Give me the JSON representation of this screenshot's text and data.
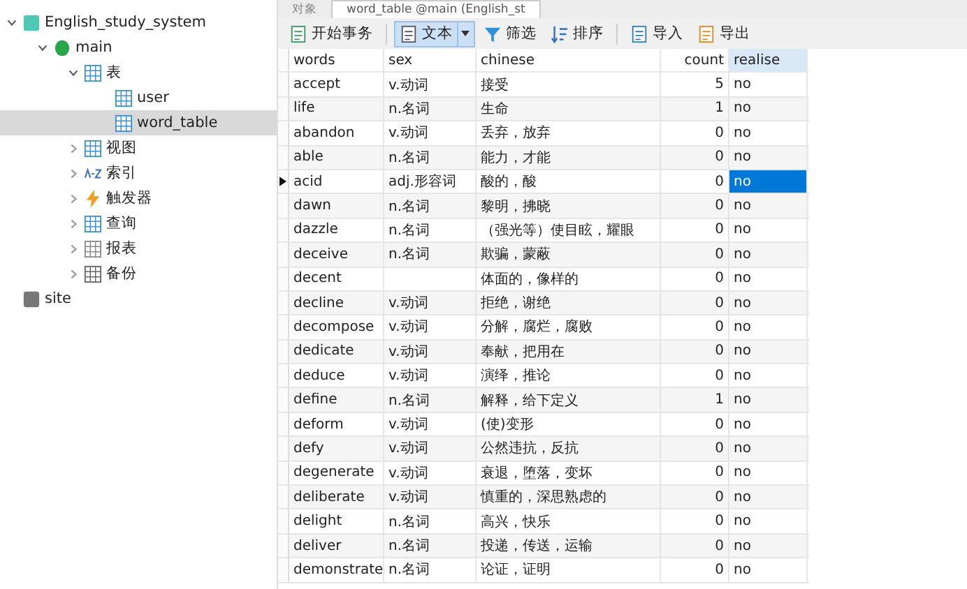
{
  "sidebar": {
    "tree": [
      {
        "label": "English_study_system",
        "kind": "connection",
        "expanded": true,
        "selected": false,
        "children": [
          {
            "label": "main",
            "kind": "database",
            "expanded": true,
            "selected": false,
            "children": [
              {
                "label": "表",
                "kind": "tables",
                "expanded": true,
                "selected": false,
                "children": [
                  {
                    "label": "user",
                    "kind": "table",
                    "selected": false
                  },
                  {
                    "label": "word_table",
                    "kind": "table",
                    "selected": true
                  }
                ]
              },
              {
                "label": "视图",
                "kind": "views",
                "expanded": false,
                "selected": false
              },
              {
                "label": "索引",
                "kind": "indexes",
                "expanded": false,
                "selected": false
              },
              {
                "label": "触发器",
                "kind": "triggers",
                "expanded": false,
                "selected": false
              },
              {
                "label": "查询",
                "kind": "queries",
                "expanded": false,
                "selected": false
              },
              {
                "label": "报表",
                "kind": "reports",
                "expanded": false,
                "selected": false
              },
              {
                "label": "备份",
                "kind": "backups",
                "expanded": false,
                "selected": false
              }
            ]
          }
        ]
      },
      {
        "label": "site",
        "kind": "connection-off",
        "selected": false
      }
    ]
  },
  "tabs": [
    {
      "label": "对象",
      "selected": false
    },
    {
      "label": "word_table @main (English_st",
      "selected": true
    }
  ],
  "toolbar": [
    {
      "label": "开始事务",
      "kind": "transaction",
      "pressed": false
    },
    {
      "label": "文本",
      "kind": "text",
      "pressed": true
    },
    {
      "label": "筛选",
      "kind": "filter",
      "pressed": false
    },
    {
      "label": "排序",
      "kind": "sort",
      "pressed": false
    },
    {
      "label": "导入",
      "kind": "import",
      "pressed": false
    },
    {
      "label": "导出",
      "kind": "export",
      "pressed": false
    }
  ],
  "table": {
    "columns": [
      {
        "label": "words",
        "selected": false
      },
      {
        "label": "sex",
        "selected": false
      },
      {
        "label": "chinese",
        "selected": false
      },
      {
        "label": "count",
        "selected": false
      },
      {
        "label": "realise",
        "selected": true
      }
    ],
    "rows": [
      {
        "cells": [
          "accept",
          "v.动词",
          "接受",
          "5",
          "no"
        ],
        "selected": false
      },
      {
        "cells": [
          "life",
          "n.名词",
          "生命",
          "1",
          "no"
        ],
        "selected": false
      },
      {
        "cells": [
          "abandon",
          "v.动词",
          "丢弃，放弃",
          "0",
          "no"
        ],
        "selected": false
      },
      {
        "cells": [
          "able",
          "n.名词",
          "能力，才能",
          "0",
          "no"
        ],
        "selected": false
      },
      {
        "cells": [
          "acid",
          "adj.形容词",
          "酸的，酸",
          "0",
          "no"
        ],
        "selected": true
      },
      {
        "cells": [
          "dawn",
          "n.名词",
          "黎明，拂晓",
          "0",
          "no"
        ],
        "selected": false
      },
      {
        "cells": [
          "dazzle",
          "n.名词",
          "（强光等）使目眩，耀眼",
          "0",
          "no"
        ],
        "selected": false
      },
      {
        "cells": [
          "deceive",
          "n.名词",
          "欺骗，蒙蔽",
          "0",
          "no"
        ],
        "selected": false
      },
      {
        "cells": [
          "decent",
          "",
          "体面的，像样的",
          "0",
          "no"
        ],
        "selected": false
      },
      {
        "cells": [
          "decline",
          "v.动词",
          "拒绝，谢绝",
          "0",
          "no"
        ],
        "selected": false
      },
      {
        "cells": [
          "decompose",
          "v.动词",
          "分解，腐烂，腐败",
          "0",
          "no"
        ],
        "selected": false
      },
      {
        "cells": [
          "dedicate",
          "v.动词",
          "奉献，把用在",
          "0",
          "no"
        ],
        "selected": false
      },
      {
        "cells": [
          "deduce",
          "v.动词",
          "演绎，推论",
          "0",
          "no"
        ],
        "selected": false
      },
      {
        "cells": [
          "define",
          "n.名词",
          "解释，给下定义",
          "1",
          "no"
        ],
        "selected": false
      },
      {
        "cells": [
          "deform",
          "v.动词",
          "(使)变形",
          "0",
          "no"
        ],
        "selected": false
      },
      {
        "cells": [
          "defy",
          "v.动词",
          "公然违抗，反抗",
          "0",
          "no"
        ],
        "selected": false
      },
      {
        "cells": [
          "degenerate",
          "v.动词",
          "衰退，堕落，变坏",
          "0",
          "no"
        ],
        "selected": false
      },
      {
        "cells": [
          "deliberate",
          "v.动词",
          "慎重的，深思熟虑的",
          "0",
          "no"
        ],
        "selected": false
      },
      {
        "cells": [
          "delight",
          "n.名词",
          "高兴，快乐",
          "0",
          "no"
        ],
        "selected": false
      },
      {
        "cells": [
          "deliver",
          "n.名词",
          "投递，传送，运输",
          "0",
          "no"
        ],
        "selected": false
      },
      {
        "cells": [
          "demonstrate",
          "n.名词",
          "论证，证明",
          "0",
          "no"
        ],
        "selected": false
      }
    ]
  }
}
